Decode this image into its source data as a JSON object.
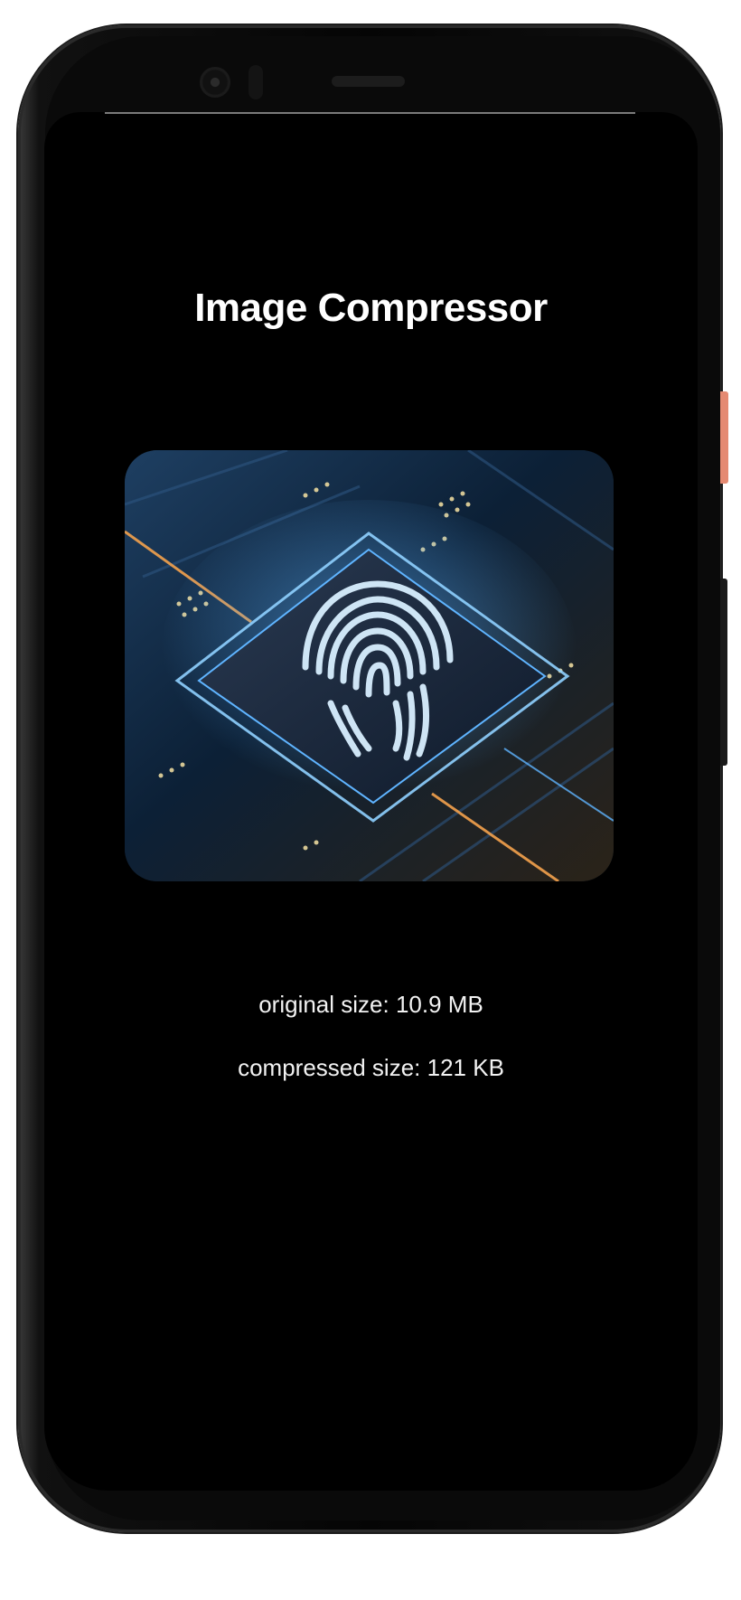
{
  "app": {
    "title": "Image Compressor"
  },
  "image": {
    "subject": "fingerprint-on-circuit-chip",
    "palette": {
      "accent_blue": "#5fb4ff",
      "accent_orange": "#f4a24d",
      "board_dark": "#0b1a2c"
    }
  },
  "stats": {
    "original_size_text": "original size: 10.9 MB",
    "compressed_size_text": "compressed size: 121 KB"
  },
  "device": {
    "side_button_color": "#e58a72"
  }
}
